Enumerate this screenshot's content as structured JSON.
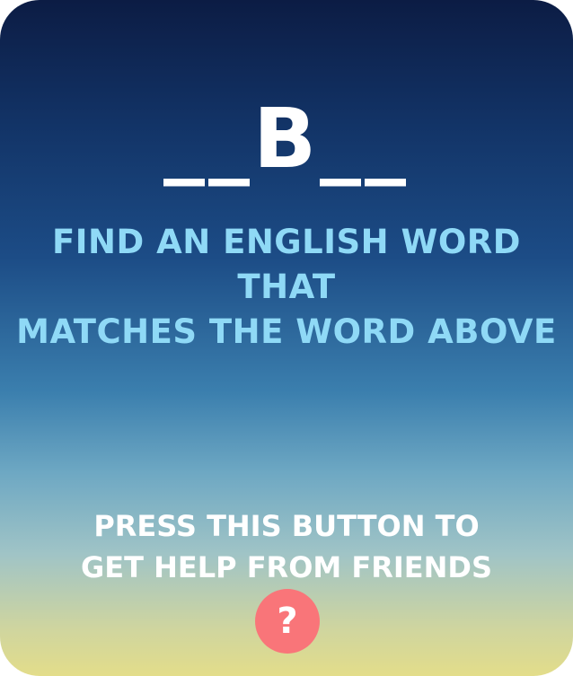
{
  "puzzle": {
    "word_pattern": "__B__",
    "instruction_line1": "FIND AN ENGLISH WORD THAT",
    "instruction_line2": "MATCHES THE WORD ABOVE"
  },
  "help": {
    "text_line1": "PRESS THIS BUTTON TO",
    "text_line2": "GET HELP FROM FRIENDS",
    "button_icon": "question-mark-icon",
    "button_glyph": "?",
    "button_color": "#f97579"
  },
  "theme": {
    "word_color": "#ffffff",
    "instruction_color": "#8fd9f6",
    "help_text_color": "#ffffff"
  }
}
